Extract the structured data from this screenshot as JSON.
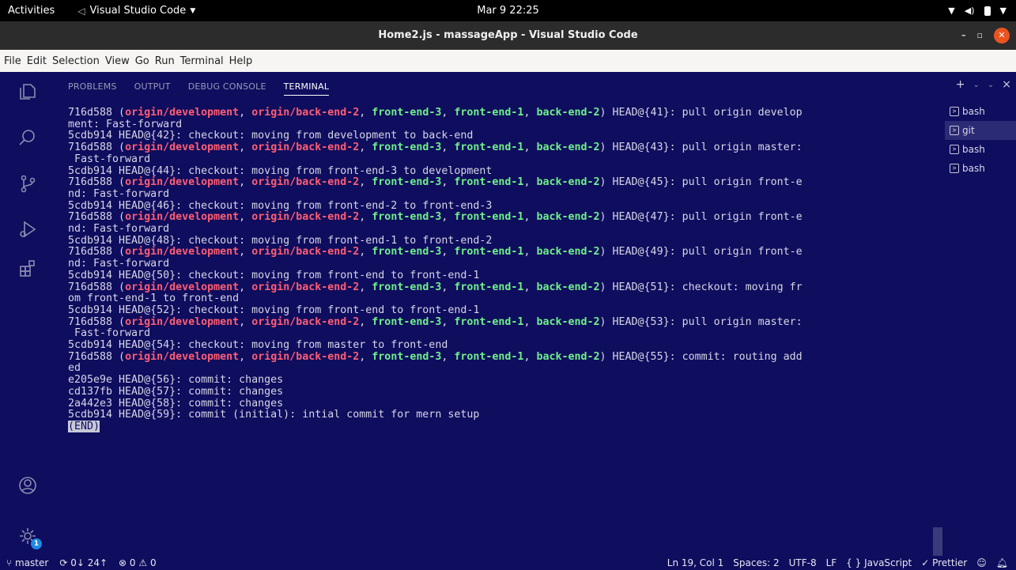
{
  "topbar": {
    "activities": "Activities",
    "app_name": "Visual Studio Code",
    "clock": "Mar 9  22:25"
  },
  "window": {
    "title": "Home2.js - massageApp - Visual Studio Code"
  },
  "menu": [
    "File",
    "Edit",
    "Selection",
    "View",
    "Go",
    "Run",
    "Terminal",
    "Help"
  ],
  "panel": {
    "tabs": [
      "PROBLEMS",
      "OUTPUT",
      "DEBUG CONSOLE",
      "TERMINAL"
    ],
    "active_tab": "TERMINAL",
    "actions": {
      "add": "+",
      "add_menu": "⌄",
      "collapse": "⌄",
      "close": "×"
    }
  },
  "terminal_list": [
    {
      "label": "bash",
      "selected": false
    },
    {
      "label": "git",
      "selected": true
    },
    {
      "label": "bash",
      "selected": false
    },
    {
      "label": "bash",
      "selected": false
    }
  ],
  "terminal": {
    "lines": [
      [
        [
          "716d588 (",
          ""
        ],
        [
          "origin/development",
          "r"
        ],
        [
          ", ",
          ""
        ],
        [
          "origin/back-end-2",
          "r"
        ],
        [
          ", ",
          ""
        ],
        [
          "front-end-3",
          "g"
        ],
        [
          ", ",
          ""
        ],
        [
          "front-end-1",
          "g"
        ],
        [
          ", ",
          ""
        ],
        [
          "back-end-2",
          "g"
        ],
        [
          ") HEAD@{41}: pull origin develop",
          ""
        ]
      ],
      [
        [
          "ment: Fast-forward",
          ""
        ]
      ],
      [
        [
          "5cdb914 HEAD@{42}: checkout: moving from development to back-end",
          ""
        ]
      ],
      [
        [
          "716d588 (",
          ""
        ],
        [
          "origin/development",
          "r"
        ],
        [
          ", ",
          ""
        ],
        [
          "origin/back-end-2",
          "r"
        ],
        [
          ", ",
          ""
        ],
        [
          "front-end-3",
          "g"
        ],
        [
          ", ",
          ""
        ],
        [
          "front-end-1",
          "g"
        ],
        [
          ", ",
          ""
        ],
        [
          "back-end-2",
          "g"
        ],
        [
          ") HEAD@{43}: pull origin master:",
          ""
        ]
      ],
      [
        [
          " Fast-forward",
          ""
        ]
      ],
      [
        [
          "5cdb914 HEAD@{44}: checkout: moving from front-end-3 to development",
          ""
        ]
      ],
      [
        [
          "716d588 (",
          ""
        ],
        [
          "origin/development",
          "r"
        ],
        [
          ", ",
          ""
        ],
        [
          "origin/back-end-2",
          "r"
        ],
        [
          ", ",
          ""
        ],
        [
          "front-end-3",
          "g"
        ],
        [
          ", ",
          ""
        ],
        [
          "front-end-1",
          "g"
        ],
        [
          ", ",
          ""
        ],
        [
          "back-end-2",
          "g"
        ],
        [
          ") HEAD@{45}: pull origin front-e",
          ""
        ]
      ],
      [
        [
          "nd: Fast-forward",
          ""
        ]
      ],
      [
        [
          "5cdb914 HEAD@{46}: checkout: moving from front-end-2 to front-end-3",
          ""
        ]
      ],
      [
        [
          "716d588 (",
          ""
        ],
        [
          "origin/development",
          "r"
        ],
        [
          ", ",
          ""
        ],
        [
          "origin/back-end-2",
          "r"
        ],
        [
          ", ",
          ""
        ],
        [
          "front-end-3",
          "g"
        ],
        [
          ", ",
          ""
        ],
        [
          "front-end-1",
          "g"
        ],
        [
          ", ",
          ""
        ],
        [
          "back-end-2",
          "g"
        ],
        [
          ") HEAD@{47}: pull origin front-e",
          ""
        ]
      ],
      [
        [
          "nd: Fast-forward",
          ""
        ]
      ],
      [
        [
          "5cdb914 HEAD@{48}: checkout: moving from front-end-1 to front-end-2",
          ""
        ]
      ],
      [
        [
          "716d588 (",
          ""
        ],
        [
          "origin/development",
          "r"
        ],
        [
          ", ",
          ""
        ],
        [
          "origin/back-end-2",
          "r"
        ],
        [
          ", ",
          ""
        ],
        [
          "front-end-3",
          "g"
        ],
        [
          ", ",
          ""
        ],
        [
          "front-end-1",
          "g"
        ],
        [
          ", ",
          ""
        ],
        [
          "back-end-2",
          "g"
        ],
        [
          ") HEAD@{49}: pull origin front-e",
          ""
        ]
      ],
      [
        [
          "nd: Fast-forward",
          ""
        ]
      ],
      [
        [
          "5cdb914 HEAD@{50}: checkout: moving from front-end to front-end-1",
          ""
        ]
      ],
      [
        [
          "716d588 (",
          ""
        ],
        [
          "origin/development",
          "r"
        ],
        [
          ", ",
          ""
        ],
        [
          "origin/back-end-2",
          "r"
        ],
        [
          ", ",
          ""
        ],
        [
          "front-end-3",
          "g"
        ],
        [
          ", ",
          ""
        ],
        [
          "front-end-1",
          "g"
        ],
        [
          ", ",
          ""
        ],
        [
          "back-end-2",
          "g"
        ],
        [
          ") HEAD@{51}: checkout: moving fr",
          ""
        ]
      ],
      [
        [
          "om front-end-1 to front-end",
          ""
        ]
      ],
      [
        [
          "5cdb914 HEAD@{52}: checkout: moving from front-end to front-end-1",
          ""
        ]
      ],
      [
        [
          "716d588 (",
          ""
        ],
        [
          "origin/development",
          "r"
        ],
        [
          ", ",
          ""
        ],
        [
          "origin/back-end-2",
          "r"
        ],
        [
          ", ",
          ""
        ],
        [
          "front-end-3",
          "g"
        ],
        [
          ", ",
          ""
        ],
        [
          "front-end-1",
          "g"
        ],
        [
          ", ",
          ""
        ],
        [
          "back-end-2",
          "g"
        ],
        [
          ") HEAD@{53}: pull origin master:",
          ""
        ]
      ],
      [
        [
          " Fast-forward",
          ""
        ]
      ],
      [
        [
          "5cdb914 HEAD@{54}: checkout: moving from master to front-end",
          ""
        ]
      ],
      [
        [
          "716d588 (",
          ""
        ],
        [
          "origin/development",
          "r"
        ],
        [
          ", ",
          ""
        ],
        [
          "origin/back-end-2",
          "r"
        ],
        [
          ", ",
          ""
        ],
        [
          "front-end-3",
          "g"
        ],
        [
          ", ",
          ""
        ],
        [
          "front-end-1",
          "g"
        ],
        [
          ", ",
          ""
        ],
        [
          "back-end-2",
          "g"
        ],
        [
          ") HEAD@{55}: commit: routing add",
          ""
        ]
      ],
      [
        [
          "ed",
          ""
        ]
      ],
      [
        [
          "e205e9e HEAD@{56}: commit: changes",
          ""
        ]
      ],
      [
        [
          "cd137fb HEAD@{57}: commit: changes",
          ""
        ]
      ],
      [
        [
          "2a442e3 HEAD@{58}: commit: changes",
          ""
        ]
      ],
      [
        [
          "5cdb914 HEAD@{59}: commit (initial): intial commit for mern setup",
          ""
        ]
      ],
      [
        [
          "(END)",
          "end"
        ]
      ]
    ]
  },
  "statusbar": {
    "branch": "master",
    "sync": "0↓ 24↑",
    "problems": "⊗ 0 ⚠ 0",
    "position": "Ln 19, Col 1",
    "spaces": "Spaces: 2",
    "encoding": "UTF-8",
    "eol": "LF",
    "language": "{ } JavaScript",
    "formatter": "✓ Prettier"
  },
  "activity_badge": "1",
  "colors": {
    "background": "#0f0d5e",
    "branch_red": "#ff5e73",
    "branch_green": "#6ff08a",
    "close_button": "#e95420"
  }
}
